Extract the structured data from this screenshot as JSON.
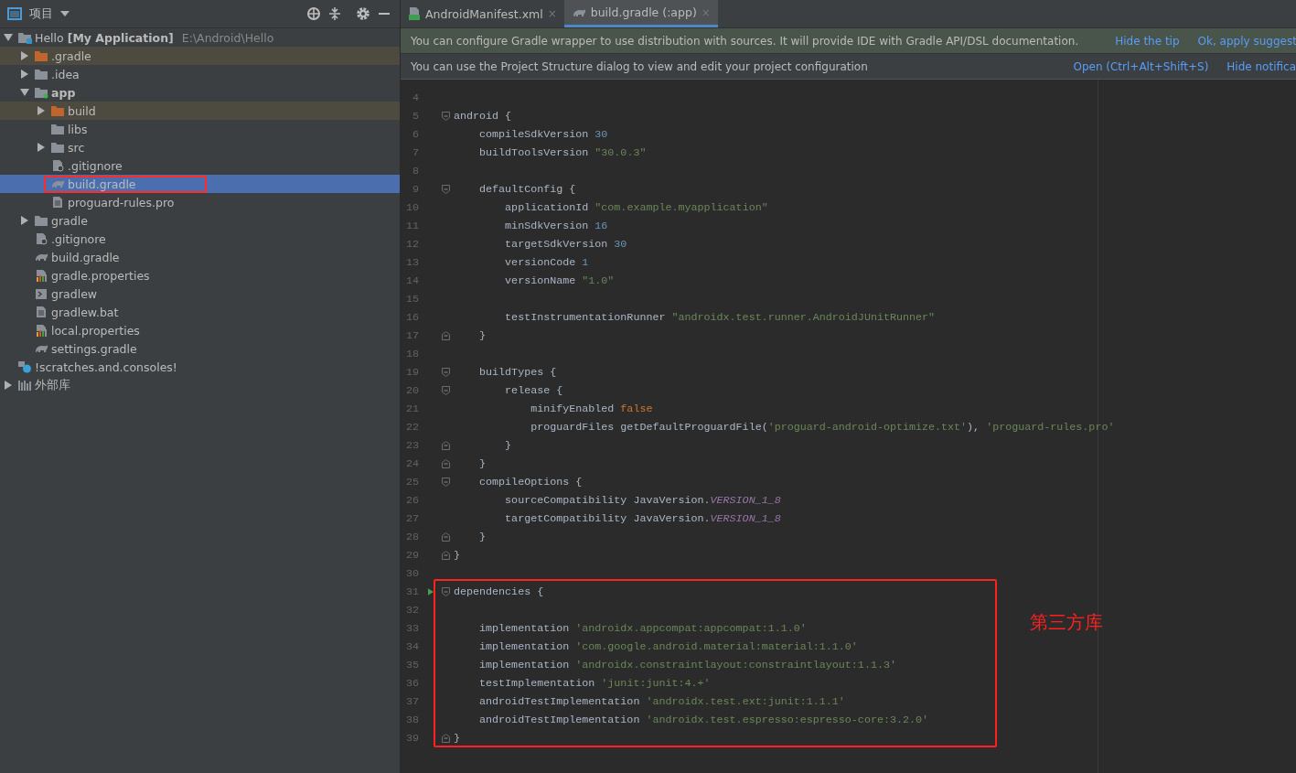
{
  "project_panel": {
    "title": "项目",
    "tree": [
      {
        "label": "Hello **[My Application]**",
        "path": "E:\\Android\\Hello",
        "kind": "project",
        "expanded": true,
        "selected": false,
        "boxed": false,
        "children": [
          {
            "label": ".gradle",
            "kind": "excluded-folder",
            "expanded": false,
            "selected": false,
            "boxed": false
          },
          {
            "label": ".idea",
            "kind": "folder",
            "expanded": false,
            "selected": false,
            "boxed": false
          },
          {
            "label": "app",
            "kind": "module",
            "expanded": true,
            "selected": false,
            "boxed": false,
            "children": [
              {
                "label": "build",
                "kind": "excluded-folder",
                "expanded": false,
                "selected": false,
                "boxed": false
              },
              {
                "label": "libs",
                "kind": "folder",
                "selected": false,
                "boxed": false
              },
              {
                "label": "src",
                "kind": "folder",
                "expanded": false,
                "selected": false,
                "boxed": false
              },
              {
                "label": ".gitignore",
                "kind": "ignore-file",
                "selected": false,
                "boxed": false
              },
              {
                "label": "build.gradle",
                "kind": "gradle-file",
                "selected": true,
                "boxed": true
              },
              {
                "label": "proguard-rules.pro",
                "kind": "text-file",
                "selected": false,
                "boxed": false
              }
            ]
          },
          {
            "label": "gradle",
            "kind": "folder",
            "expanded": false,
            "selected": false,
            "boxed": false
          },
          {
            "label": ".gitignore",
            "kind": "ignore-file",
            "selected": false,
            "boxed": false
          },
          {
            "label": "build.gradle",
            "kind": "gradle-file",
            "selected": false,
            "boxed": false
          },
          {
            "label": "gradle.properties",
            "kind": "properties-file",
            "selected": false,
            "boxed": false
          },
          {
            "label": "gradlew",
            "kind": "script-file",
            "selected": false,
            "boxed": false
          },
          {
            "label": "gradlew.bat",
            "kind": "text-file",
            "selected": false,
            "boxed": false
          },
          {
            "label": "local.properties",
            "kind": "properties-file",
            "selected": false,
            "boxed": false
          },
          {
            "label": "settings.gradle",
            "kind": "gradle-file",
            "selected": false,
            "boxed": false
          }
        ]
      },
      {
        "label": "!scratches.and.consoles!",
        "kind": "scratches",
        "selected": false,
        "boxed": false
      },
      {
        "label": "外部库",
        "kind": "library",
        "expanded": false,
        "selected": false,
        "boxed": false
      }
    ]
  },
  "tabs": [
    {
      "label": "AndroidManifest.xml",
      "kind": "manifest",
      "close": "×",
      "selected": false
    },
    {
      "label": "build.gradle (:app)",
      "kind": "gradle",
      "close": "×",
      "selected": true
    }
  ],
  "banners": [
    {
      "kind": "tip",
      "text": "You can configure Gradle wrapper to use distribution with sources. It will provide IDE with Gradle API/DSL documentation.",
      "links": [
        "Hide the tip",
        "Ok, apply suggest"
      ]
    },
    {
      "kind": "notice",
      "text": "You can use the Project Structure dialog to view and edit your project configuration",
      "links": [
        "Open (Ctrl+Alt+Shift+S)",
        "Hide notifica"
      ]
    }
  ],
  "editor": {
    "blocks": [
      {
        "kind": "plain",
        "lines": [
          {
            "number": "4"
          },
          {
            "number": "5",
            "fold_start": true,
            "tokens": [
              {
                "kind": "plain",
                "text": "android {"
              }
            ]
          },
          {
            "number": "6",
            "tokens": [
              {
                "kind": "plain",
                "text": "    compileSdkVersion "
              },
              {
                "kind": "number",
                "text": "30"
              }
            ]
          },
          {
            "number": "7",
            "tokens": [
              {
                "kind": "plain",
                "text": "    buildToolsVersion "
              },
              {
                "kind": "string",
                "text": "\"30.0.3\""
              }
            ]
          },
          {
            "number": "8"
          },
          {
            "number": "9",
            "fold_start": true,
            "tokens": [
              {
                "kind": "plain",
                "text": "    defaultConfig {"
              }
            ]
          },
          {
            "number": "10",
            "tokens": [
              {
                "kind": "plain",
                "text": "        applicationId "
              },
              {
                "kind": "string",
                "text": "\"com.example.myapplication\""
              }
            ]
          },
          {
            "number": "11",
            "tokens": [
              {
                "kind": "plain",
                "text": "        minSdkVersion "
              },
              {
                "kind": "number",
                "text": "16"
              }
            ]
          },
          {
            "number": "12",
            "tokens": [
              {
                "kind": "plain",
                "text": "        targetSdkVersion "
              },
              {
                "kind": "number",
                "text": "30"
              }
            ]
          },
          {
            "number": "13",
            "tokens": [
              {
                "kind": "plain",
                "text": "        versionCode "
              },
              {
                "kind": "number",
                "text": "1"
              }
            ]
          },
          {
            "number": "14",
            "tokens": [
              {
                "kind": "plain",
                "text": "        versionName "
              },
              {
                "kind": "string",
                "text": "\"1.0\""
              }
            ]
          },
          {
            "number": "15"
          },
          {
            "number": "16",
            "tokens": [
              {
                "kind": "plain",
                "text": "        testInstrumentationRunner "
              },
              {
                "kind": "string",
                "text": "\"androidx.test.runner.AndroidJUnitRunner\""
              }
            ]
          },
          {
            "number": "17",
            "fold_end": true,
            "tokens": [
              {
                "kind": "plain",
                "text": "    }"
              }
            ]
          },
          {
            "number": "18"
          },
          {
            "number": "19",
            "fold_start": true,
            "tokens": [
              {
                "kind": "plain",
                "text": "    buildTypes {"
              }
            ]
          },
          {
            "number": "20",
            "fold_start": true,
            "tokens": [
              {
                "kind": "plain",
                "text": "        release {"
              }
            ]
          },
          {
            "number": "21",
            "tokens": [
              {
                "kind": "plain",
                "text": "            minifyEnabled "
              },
              {
                "kind": "keyword",
                "text": "false"
              }
            ]
          },
          {
            "number": "22",
            "tokens": [
              {
                "kind": "plain",
                "text": "            proguardFiles getDefaultProguardFile("
              },
              {
                "kind": "string",
                "text": "'proguard-android-optimize.txt'"
              },
              {
                "kind": "plain",
                "text": "), "
              },
              {
                "kind": "string",
                "text": "'proguard-rules.pro'"
              }
            ]
          },
          {
            "number": "23",
            "fold_end": true,
            "tokens": [
              {
                "kind": "plain",
                "text": "        }"
              }
            ]
          },
          {
            "number": "24",
            "fold_end": true,
            "tokens": [
              {
                "kind": "plain",
                "text": "    }"
              }
            ]
          },
          {
            "number": "25",
            "fold_start": true,
            "tokens": [
              {
                "kind": "plain",
                "text": "    compileOptions {"
              }
            ]
          },
          {
            "number": "26",
            "tokens": [
              {
                "kind": "plain",
                "text": "        sourceCompatibility JavaVersion."
              },
              {
                "kind": "constant",
                "text": "VERSION_1_8"
              }
            ]
          },
          {
            "number": "27",
            "tokens": [
              {
                "kind": "plain",
                "text": "        targetCompatibility JavaVersion."
              },
              {
                "kind": "constant",
                "text": "VERSION_1_8"
              }
            ]
          },
          {
            "number": "28",
            "fold_end": true,
            "tokens": [
              {
                "kind": "plain",
                "text": "    }"
              }
            ]
          },
          {
            "number": "29",
            "fold_end": true,
            "tokens": [
              {
                "kind": "plain",
                "text": "}"
              }
            ]
          },
          {
            "number": "30"
          }
        ]
      },
      {
        "kind": "annotated",
        "annotation": "第三方库",
        "lines": [
          {
            "number": "31",
            "fold_start": true,
            "run": true,
            "tokens": [
              {
                "kind": "plain",
                "text": "dependencies {"
              }
            ]
          },
          {
            "number": "32"
          },
          {
            "number": "33",
            "tokens": [
              {
                "kind": "plain",
                "text": "    implementation "
              },
              {
                "kind": "string",
                "text": "'androidx.appcompat:appcompat:1.1.0'"
              }
            ]
          },
          {
            "number": "34",
            "tokens": [
              {
                "kind": "plain",
                "text": "    implementation "
              },
              {
                "kind": "string",
                "text": "'com.google.android.material:material:1.1.0'"
              }
            ]
          },
          {
            "number": "35",
            "tokens": [
              {
                "kind": "plain",
                "text": "    implementation "
              },
              {
                "kind": "string",
                "text": "'androidx.constraintlayout:constraintlayout:1.1.3'"
              }
            ]
          },
          {
            "number": "36",
            "tokens": [
              {
                "kind": "plain",
                "text": "    testImplementation "
              },
              {
                "kind": "string",
                "text": "'junit:junit:4.+'"
              }
            ]
          },
          {
            "number": "37",
            "tokens": [
              {
                "kind": "plain",
                "text": "    androidTestImplementation "
              },
              {
                "kind": "string",
                "text": "'androidx.test.ext:junit:1.1.1'"
              }
            ]
          },
          {
            "number": "38",
            "tokens": [
              {
                "kind": "plain",
                "text": "    androidTestImplementation "
              },
              {
                "kind": "string",
                "text": "'androidx.test.espresso:espresso-core:3.2.0'"
              }
            ]
          },
          {
            "number": "39",
            "fold_end": true,
            "tokens": [
              {
                "kind": "plain",
                "text": "}"
              }
            ]
          }
        ]
      }
    ]
  }
}
